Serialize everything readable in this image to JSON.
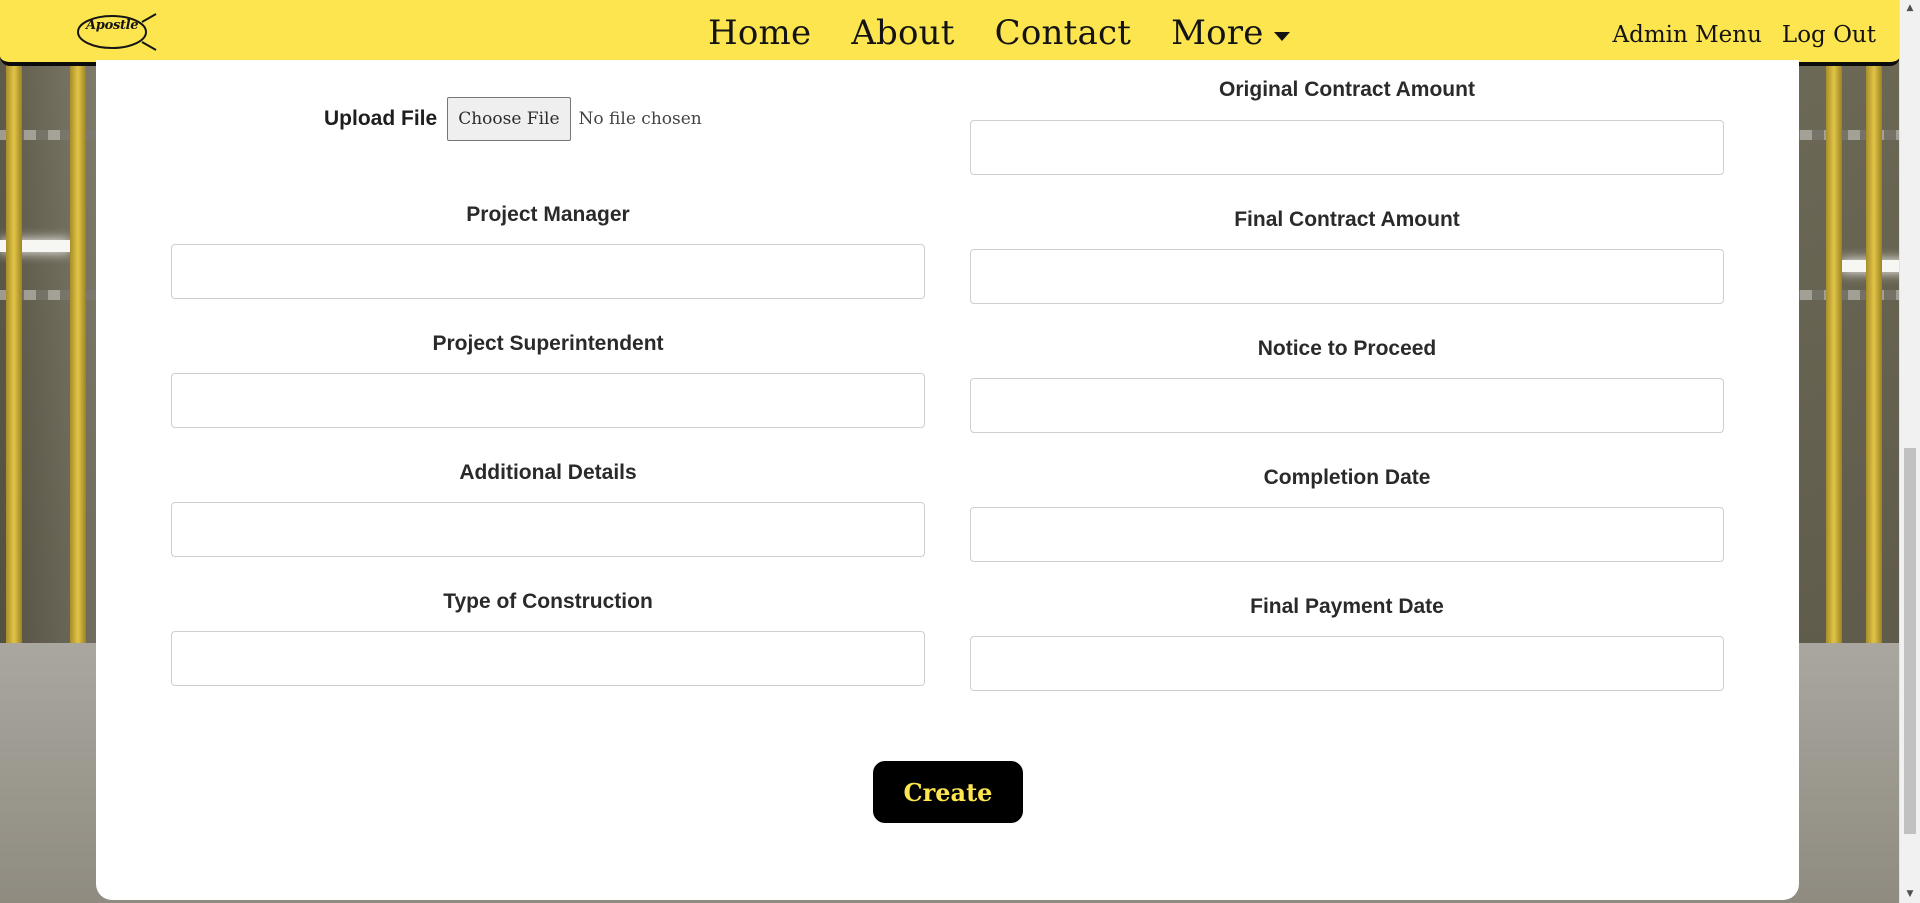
{
  "navbar": {
    "logo_text": "Apostle",
    "links": [
      "Home",
      "About",
      "Contact",
      "More"
    ],
    "admin_menu": "Admin Menu",
    "logout": "Log Out",
    "bg_color": "#fde54f"
  },
  "form": {
    "upload": {
      "label": "Upload File",
      "button": "Choose File",
      "status": "No file chosen"
    },
    "left_fields": [
      {
        "label": "Project Manager",
        "value": ""
      },
      {
        "label": "Project Superintendent",
        "value": ""
      },
      {
        "label": "Additional Details",
        "value": ""
      },
      {
        "label": "Type of Construction",
        "value": ""
      }
    ],
    "right_fields": [
      {
        "label": "Original Contract Amount",
        "value": ""
      },
      {
        "label": "Final Contract Amount",
        "value": ""
      },
      {
        "label": "Notice to Proceed",
        "value": ""
      },
      {
        "label": "Completion Date",
        "value": ""
      },
      {
        "label": "Final Payment Date",
        "value": ""
      }
    ],
    "submit": "Create"
  },
  "colors": {
    "accent": "#fde54f",
    "button_bg": "#000000"
  }
}
